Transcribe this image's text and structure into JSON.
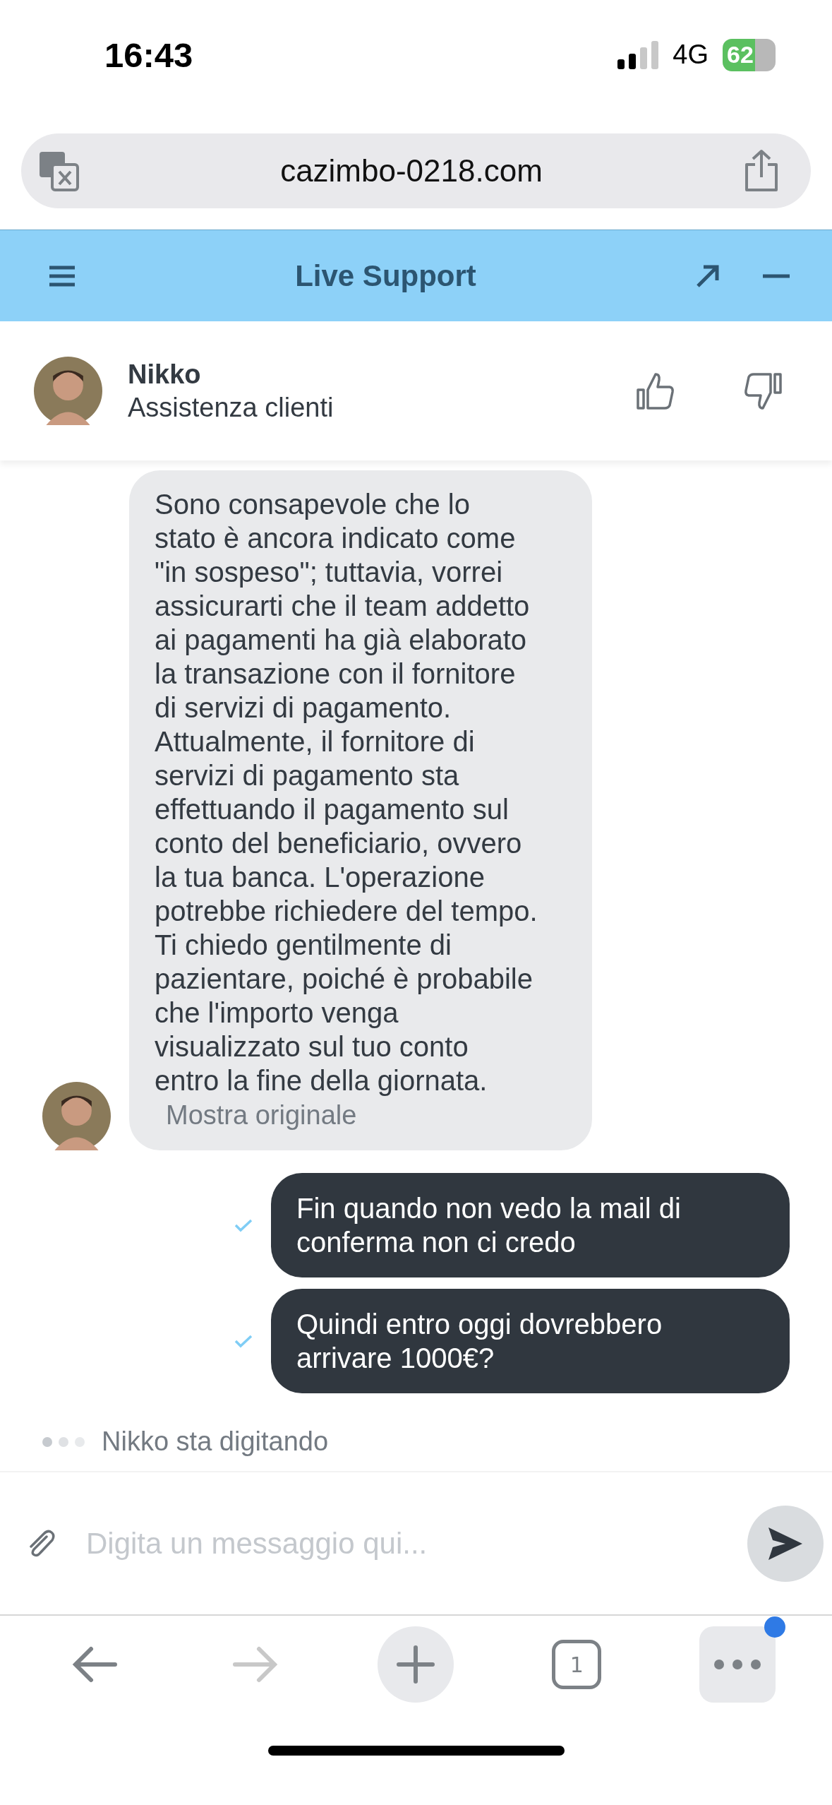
{
  "status_bar": {
    "time": "16:43",
    "network": "4G",
    "battery": "62"
  },
  "url_bar": {
    "url": "cazimbo-0218.com"
  },
  "chat_header": {
    "title": "Live Support"
  },
  "agent": {
    "name": "Nikko",
    "role": "Assistenza clienti"
  },
  "messages": [
    {
      "kind": "received",
      "text": "Sono consapevole che lo stato è ancora indicato come \"in sospeso\"; tuttavia, vorrei assicurarti che il team addetto ai pagamenti ha già elaborato la transazione con il fornitore di servizi di pagamento. Attualmente, il fornitore di servizi di pagamento sta effettuando il pagamento sul conto del beneficiario, ovvero la tua banca. L'operazione potrebbe richiedere del tempo. Ti chiedo gentilmente di pazientare, poiché è probabile che l'importo venga visualizzato sul tuo conto entro la fine della giornata.",
      "link": "Mostra originale"
    },
    {
      "kind": "sent",
      "text": "Fin quando non vedo la mail di conferma non ci credo",
      "delivered": true
    },
    {
      "kind": "sent",
      "text": "Quindi entro oggi dovrebbero arrivare 1000€?",
      "delivered": true
    }
  ],
  "typing": {
    "text": "Nikko sta digitando"
  },
  "composer": {
    "placeholder": "Digita un messaggio qui..."
  },
  "toolbar": [
    {
      "kind": "back",
      "disabled": false
    },
    {
      "kind": "forward",
      "disabled": true
    },
    {
      "kind": "new"
    },
    {
      "kind": "tabs",
      "count": "1"
    },
    {
      "kind": "more",
      "badge": true
    }
  ]
}
